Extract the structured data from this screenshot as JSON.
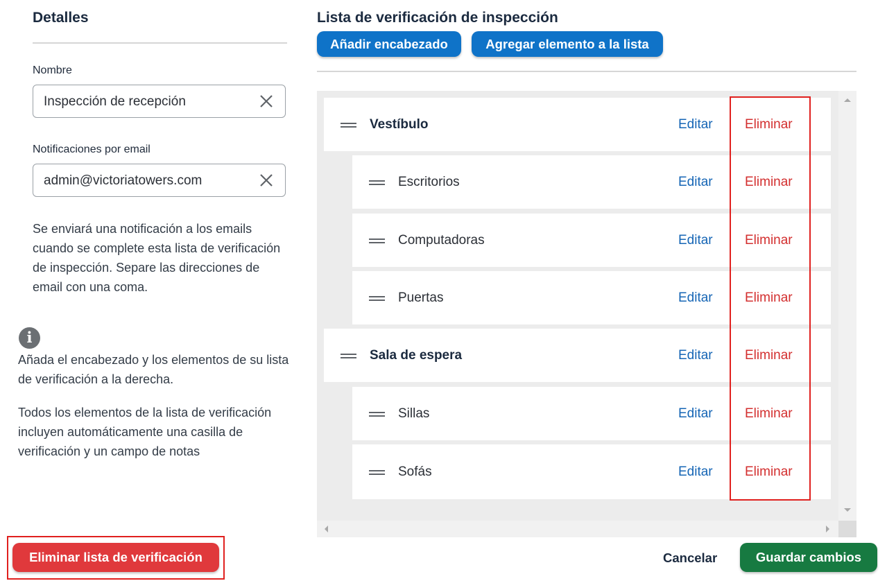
{
  "details": {
    "heading": "Detalles",
    "name_label": "Nombre",
    "name_value": "Inspección de recepción",
    "email_label": "Notificaciones por email",
    "email_value": "admin@victoriatowers.com",
    "email_help": "Se enviará una notificación a los emails cuando se complete esta lista de verificación de inspección. Separe las direcciones de email con una coma.",
    "info_icon": "info-icon",
    "info_text_1": "Añada el encabezado y los elementos de su lista de verificación a la derecha.",
    "info_text_2": "Todos los elementos de la lista de verificación incluyen automáticamente una casilla de verificación y un campo de notas",
    "delete_list_label": "Eliminar lista de verificación"
  },
  "checklist": {
    "heading": "Lista de verificación de inspección",
    "add_header_label": "Añadir encabezado",
    "add_item_label": "Agregar elemento a la lista",
    "edit_label": "Editar",
    "delete_label": "Eliminar",
    "items": [
      {
        "type": "heading",
        "label": "Vestíbulo"
      },
      {
        "type": "item",
        "label": "Escritorios"
      },
      {
        "type": "item",
        "label": "Computadoras"
      },
      {
        "type": "item",
        "label": "Puertas"
      },
      {
        "type": "heading",
        "label": "Sala de espera"
      },
      {
        "type": "item",
        "label": "Sillas"
      },
      {
        "type": "item",
        "label": "Sofás"
      }
    ]
  },
  "footer": {
    "cancel_label": "Cancelar",
    "save_label": "Guardar cambios"
  },
  "colors": {
    "primary_blue": "#0f73c8",
    "danger_red": "#e0393c",
    "save_green": "#177a41",
    "highlight_red": "#e0201e"
  }
}
